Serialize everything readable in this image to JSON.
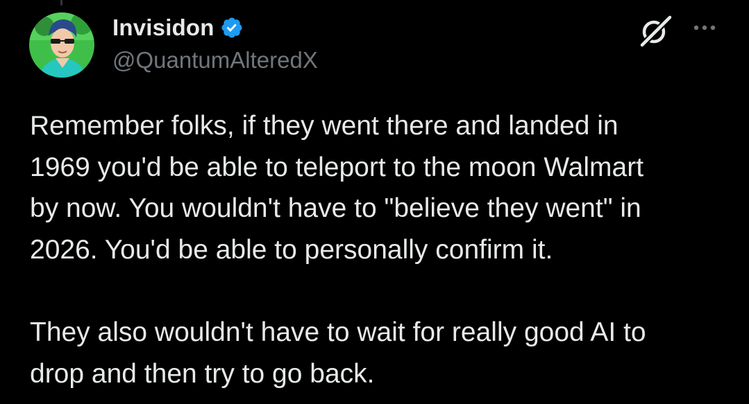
{
  "author": {
    "display_name": "Invisidon",
    "handle": "@QuantumAlteredX",
    "avatar": "anime-style-man-with-sunglasses",
    "verified": true
  },
  "colors": {
    "background": "#000000",
    "primary_text": "#e7e9ea",
    "secondary_text": "#71767b",
    "verified_blue": "#1d9bf0"
  },
  "icons": {
    "verified": "verified-badge-icon",
    "grok": "grok-icon",
    "more": "more-options-icon"
  },
  "tweet": {
    "paragraphs": [
      "Remember folks, if they went there and landed in\n1969 you'd be able to teleport to the moon Walmart\nby now.  You wouldn't have to \"believe they went\" in\n2026.  You'd be able to personally confirm it.",
      "They also wouldn't have to wait for really good AI to\ndrop and then try to go back."
    ]
  }
}
